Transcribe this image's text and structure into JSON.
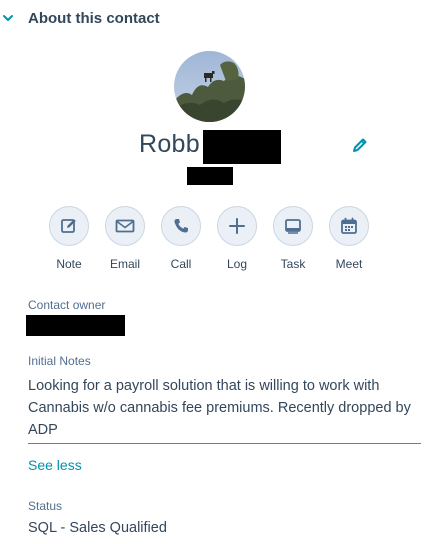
{
  "section": {
    "title": "About this contact"
  },
  "contact": {
    "first_name": "Robb"
  },
  "actions": [
    {
      "label": "Note",
      "icon": "edit-note-icon"
    },
    {
      "label": "Email",
      "icon": "envelope-icon"
    },
    {
      "label": "Call",
      "icon": "phone-icon"
    },
    {
      "label": "Log",
      "icon": "plus-icon"
    },
    {
      "label": "Task",
      "icon": "task-icon"
    },
    {
      "label": "Meet",
      "icon": "calendar-icon"
    }
  ],
  "fields": {
    "owner_label": "Contact owner",
    "notes_label": "Initial Notes",
    "notes_value": "Looking for a payroll solution that is willing to work with Cannabis w/o cannabis fee premiums. Recently dropped by ADP",
    "see_less": "See less",
    "status_label": "Status",
    "status_value": "SQL - Sales Qualified"
  },
  "colors": {
    "accent": "#0091ae",
    "text": "#33475b",
    "button_bg": "#eaf0f6"
  }
}
